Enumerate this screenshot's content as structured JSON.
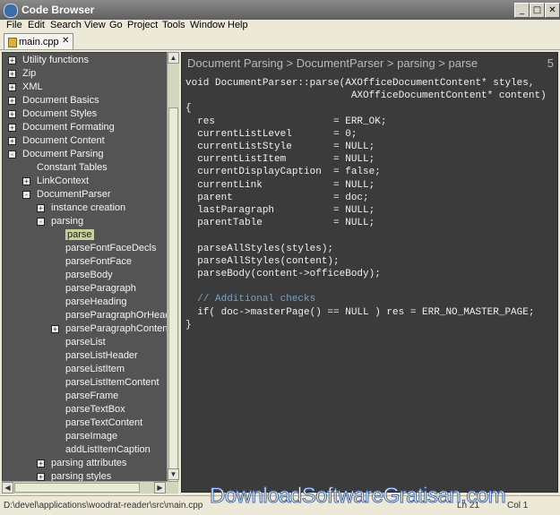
{
  "window": {
    "title": "Code Browser",
    "controls": [
      "_",
      "□",
      "✕"
    ]
  },
  "menu": [
    "File",
    "Edit",
    "Search",
    "View",
    "Go",
    "Project",
    "Tools",
    "Window",
    "Help"
  ],
  "tabs": [
    {
      "label": "main.cpp",
      "close": "✕"
    }
  ],
  "tree": {
    "rows": [
      {
        "label": "Utility functions",
        "level": 0,
        "expander": "+"
      },
      {
        "label": "Zip",
        "level": 0,
        "expander": "+"
      },
      {
        "label": "XML",
        "level": 0,
        "expander": "+"
      },
      {
        "label": "Document Basics",
        "level": 0,
        "expander": "+"
      },
      {
        "label": "Document Styles",
        "level": 0,
        "expander": "+"
      },
      {
        "label": "Document Formating",
        "level": 0,
        "expander": "+"
      },
      {
        "label": "Document Content",
        "level": 0,
        "expander": "+"
      },
      {
        "label": "Document Parsing",
        "level": 0,
        "expander": "-"
      },
      {
        "label": "Constant Tables",
        "level": 1,
        "expander": ""
      },
      {
        "label": "LinkContext",
        "level": 1,
        "expander": "+"
      },
      {
        "label": "DocumentParser",
        "level": 1,
        "expander": "-"
      },
      {
        "label": "instance creation",
        "level": 2,
        "expander": "+"
      },
      {
        "label": "parsing",
        "level": 2,
        "expander": "-"
      },
      {
        "label": "parse",
        "level": 3,
        "expander": "",
        "selected": true
      },
      {
        "label": "parseFontFaceDecls",
        "level": 3,
        "expander": ""
      },
      {
        "label": "parseFontFace",
        "level": 3,
        "expander": ""
      },
      {
        "label": "parseBody",
        "level": 3,
        "expander": ""
      },
      {
        "label": "parseParagraph",
        "level": 3,
        "expander": ""
      },
      {
        "label": "parseHeading",
        "level": 3,
        "expander": ""
      },
      {
        "label": "parseParagraphOrHead",
        "level": 3,
        "expander": ""
      },
      {
        "label": "parseParagraphContent",
        "level": 3,
        "expander": "+"
      },
      {
        "label": "parseList",
        "level": 3,
        "expander": ""
      },
      {
        "label": "parseListHeader",
        "level": 3,
        "expander": ""
      },
      {
        "label": "parseListItem",
        "level": 3,
        "expander": ""
      },
      {
        "label": "parseListItemContent",
        "level": 3,
        "expander": ""
      },
      {
        "label": "parseFrame",
        "level": 3,
        "expander": ""
      },
      {
        "label": "parseTextBox",
        "level": 3,
        "expander": ""
      },
      {
        "label": "parseTextContent",
        "level": 3,
        "expander": ""
      },
      {
        "label": "parseImage",
        "level": 3,
        "expander": ""
      },
      {
        "label": "addListItemCaption",
        "level": 3,
        "expander": ""
      },
      {
        "label": "parsing attributes",
        "level": 2,
        "expander": "+"
      },
      {
        "label": "parsing styles",
        "level": 2,
        "expander": "+"
      }
    ]
  },
  "editor": {
    "breadcrumb": "Document Parsing > DocumentParser > parsing > parse",
    "line_number": "5",
    "code": [
      {
        "text": "void DocumentParser::parse(AXOfficeDocumentContent* styles,",
        "kind": "code"
      },
      {
        "text": "                            AXOfficeDocumentContent* content)",
        "kind": "code"
      },
      {
        "text": "{",
        "kind": "code"
      },
      {
        "text": "  res                    = ERR_OK;",
        "kind": "code"
      },
      {
        "text": "  currentListLevel       = 0;",
        "kind": "code"
      },
      {
        "text": "  currentListStyle       = NULL;",
        "kind": "code"
      },
      {
        "text": "  currentListItem        = NULL;",
        "kind": "code"
      },
      {
        "text": "  currentDisplayCaption  = false;",
        "kind": "code"
      },
      {
        "text": "  currentLink            = NULL;",
        "kind": "code"
      },
      {
        "text": "  parent                 = doc;",
        "kind": "code"
      },
      {
        "text": "  lastParagraph          = NULL;",
        "kind": "code"
      },
      {
        "text": "  parentTable            = NULL;",
        "kind": "code"
      },
      {
        "text": "",
        "kind": "code"
      },
      {
        "text": "  parseAllStyles(styles);",
        "kind": "code"
      },
      {
        "text": "  parseAllStyles(content);",
        "kind": "code"
      },
      {
        "text": "  parseBody(content->officeBody);",
        "kind": "code"
      },
      {
        "text": "",
        "kind": "code"
      },
      {
        "text": "  // Additional checks",
        "kind": "comment"
      },
      {
        "text": "  if( doc->masterPage() == NULL ) res = ERR_NO_MASTER_PAGE;",
        "kind": "code"
      },
      {
        "text": "}",
        "kind": "code"
      }
    ]
  },
  "status": {
    "path": "D:\\devel\\applications\\woodrat-reader\\src\\main.cpp",
    "line": "Ln 21",
    "col": "Col 1"
  },
  "watermark": "DownloadSoftwareGratisan.com",
  "scrollbars": {
    "up": "▲",
    "down": "▼",
    "left": "◀",
    "right": "▶"
  }
}
